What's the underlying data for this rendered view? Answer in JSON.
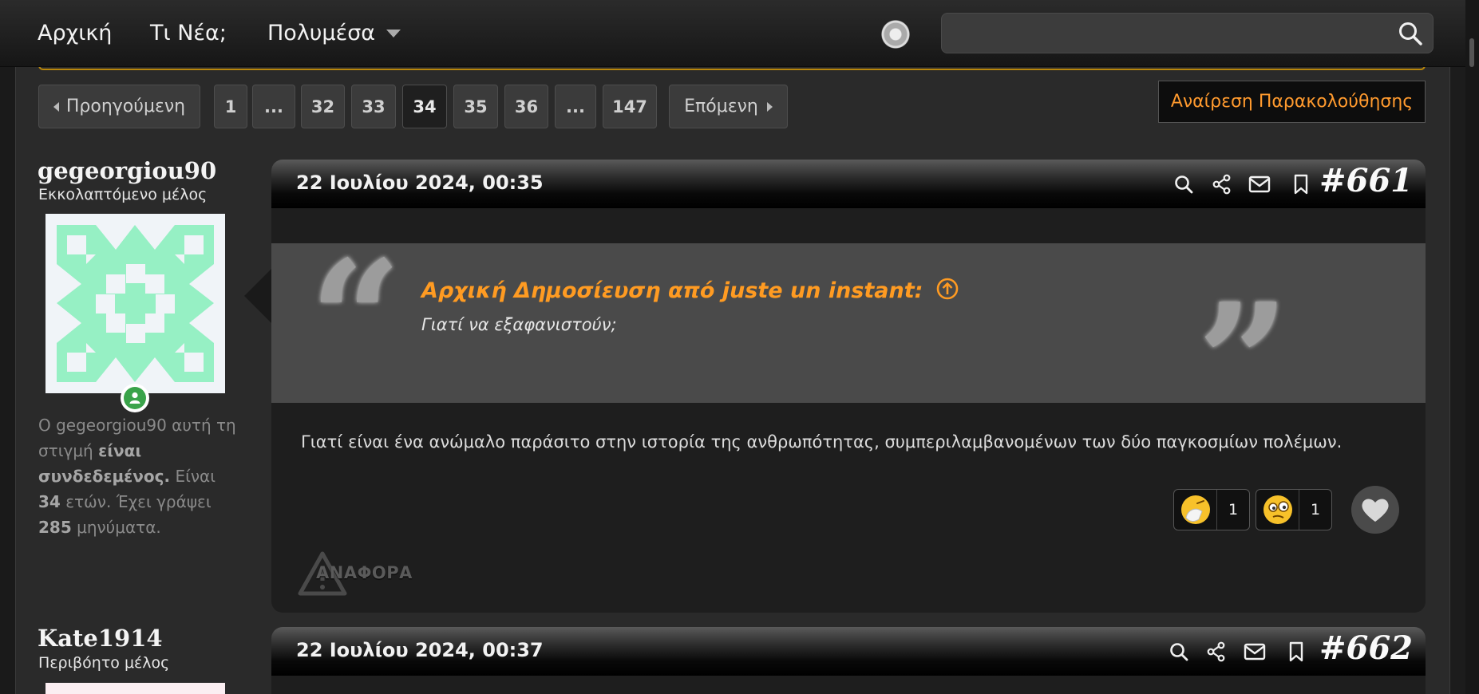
{
  "nav": {
    "items": [
      "Αρχική",
      "Τι Νέα;",
      "Πολυμέσα"
    ],
    "search_placeholder": ""
  },
  "pagination": {
    "prev": "Προηγούμενη",
    "next": "Επόμενη",
    "pages": [
      "1",
      "...",
      "32",
      "33",
      "34",
      "35",
      "36",
      "...",
      "147"
    ],
    "current": "34",
    "unwatch": "Αναίρεση Παρακολούθησης"
  },
  "posts": [
    {
      "username": "gegeorgiou90",
      "user_title": "Εκκολαπτόμενο μέλος",
      "info": {
        "prefix": "Ο gegeorgiou90 αυτή τη στιγμή ",
        "status": "είναι συνδεδεμένος.",
        "age_pre": " Είναι ",
        "age": "34",
        "posts_pre": " ετών. Έχει γράψει ",
        "post_count": "285",
        "posts_suf": " μηνύματα."
      },
      "date": "22 Ιουλίου 2024, 00:35",
      "number": "#661",
      "quote_title": "Αρχική Δημοσίευση από juste un instant:",
      "quote_text": "Γιατί να εξαφανιστούν;",
      "body": "Γιατί είναι ένα ανώμαλο παράσιτο στην ιστορία της ανθρωπότητας, συμπεριλαμβανομένων των δύο παγκοσμίων πολέμων.",
      "reactions": [
        {
          "icon": "facepalm-emoji-icon",
          "count": "1"
        },
        {
          "icon": "confused-emoji-icon",
          "count": "1"
        }
      ],
      "report": "ΑΝΑΦΟΡΑ"
    },
    {
      "username": "Kate1914",
      "user_title": "Περιβόητο μέλος",
      "date": "22 Ιουλίου 2024, 00:37",
      "number": "#662"
    }
  ],
  "colors": {
    "accent": "#ff9b22",
    "online": "#3aa34a",
    "avatar_pattern": "#96f0c4"
  }
}
